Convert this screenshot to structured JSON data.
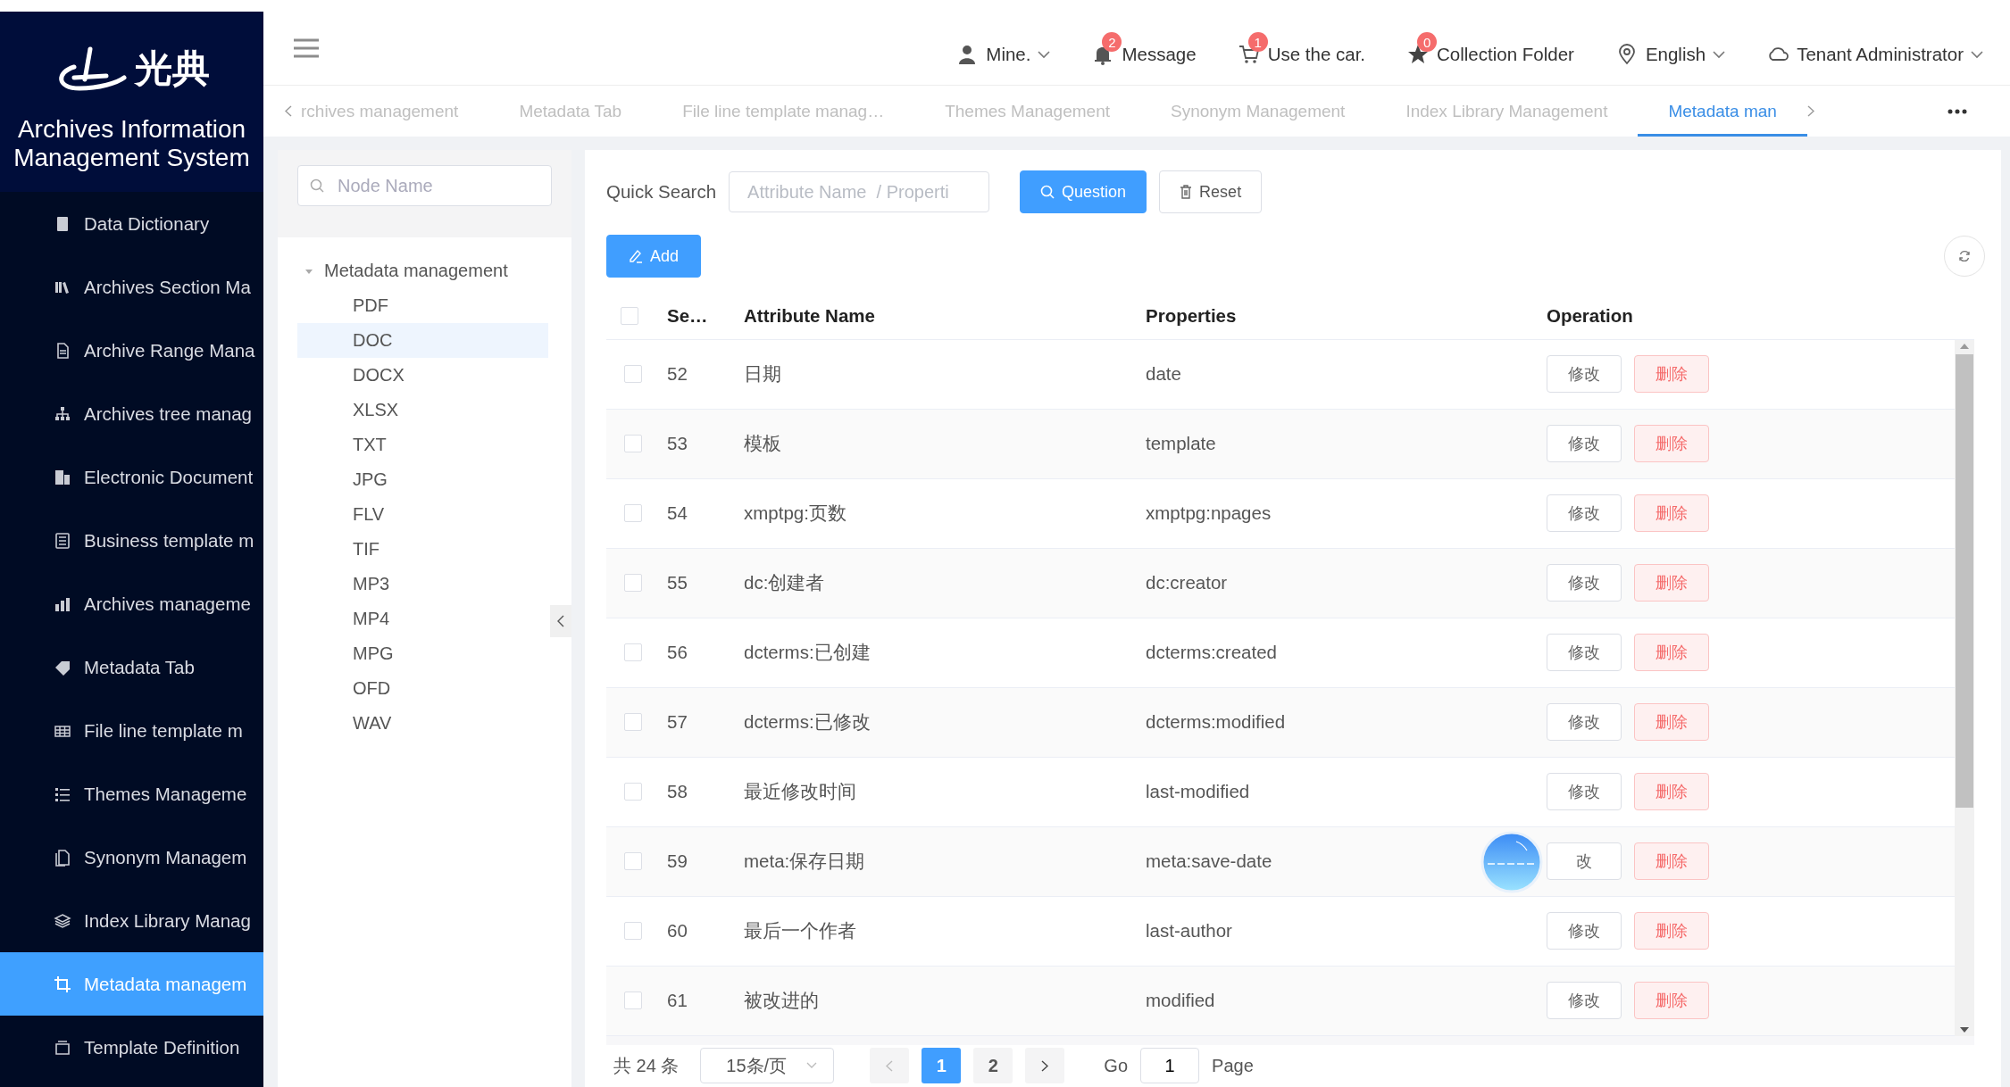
{
  "sidebar": {
    "logo_text": "光典",
    "system_title": "Archives Information Management System",
    "items": [
      {
        "label": "Data Dictionary",
        "selected": false
      },
      {
        "label": "Archives Section Ma",
        "selected": false
      },
      {
        "label": "Archive Range Mana",
        "selected": false
      },
      {
        "label": "Archives tree manag",
        "selected": false
      },
      {
        "label": "Electronic Document",
        "selected": false
      },
      {
        "label": "Business template m",
        "selected": false
      },
      {
        "label": "Archives manageme",
        "selected": false
      },
      {
        "label": "Metadata Tab",
        "selected": false
      },
      {
        "label": "File line template m",
        "selected": false
      },
      {
        "label": "Themes Manageme",
        "selected": false
      },
      {
        "label": "Synonym Managem",
        "selected": false
      },
      {
        "label": "Index Library Manag",
        "selected": false
      },
      {
        "label": "Metadata managem",
        "selected": true
      },
      {
        "label": "Template Definition",
        "selected": false
      }
    ]
  },
  "header": {
    "items": [
      {
        "kind": "user",
        "label": "Mine.",
        "dropdown": true
      },
      {
        "kind": "bell",
        "label": "Message",
        "badge": "2"
      },
      {
        "kind": "cart",
        "label": "Use the car.",
        "badge": "1"
      },
      {
        "kind": "star",
        "label": "Collection Folder",
        "badge": "0"
      },
      {
        "kind": "pin",
        "label": "English",
        "dropdown": true
      },
      {
        "kind": "cloud",
        "label": "Tenant Administrator",
        "dropdown": true
      }
    ]
  },
  "tabs": [
    {
      "label": "rchives management",
      "selected": false
    },
    {
      "label": "Metadata Tab",
      "selected": false
    },
    {
      "label": "File line template manag…",
      "selected": false
    },
    {
      "label": "Themes Management",
      "selected": false
    },
    {
      "label": "Synonym Management",
      "selected": false
    },
    {
      "label": "Index Library Management",
      "selected": false
    },
    {
      "label": "Metadata man",
      "selected": true
    }
  ],
  "tree": {
    "search_placeholder": "Node Name",
    "root": {
      "label": "Metadata management",
      "expanded": true,
      "children": [
        {
          "label": "PDF",
          "selected": false
        },
        {
          "label": "DOC",
          "selected": true
        },
        {
          "label": "DOCX",
          "selected": false
        },
        {
          "label": "XLSX",
          "selected": false
        },
        {
          "label": "TXT",
          "selected": false
        },
        {
          "label": "JPG",
          "selected": false
        },
        {
          "label": "FLV",
          "selected": false
        },
        {
          "label": "TIF",
          "selected": false
        },
        {
          "label": "MP3",
          "selected": false
        },
        {
          "label": "MP4",
          "selected": false
        },
        {
          "label": "MPG",
          "selected": false
        },
        {
          "label": "OFD",
          "selected": false
        },
        {
          "label": "WAV",
          "selected": false
        }
      ]
    }
  },
  "toolbar": {
    "quick_search_label": "Quick Search",
    "search_placeholder": "Attribute Name  / Properti",
    "question_button": "Question",
    "reset_button": "Reset",
    "add_button": "Add"
  },
  "table": {
    "select_all_checked": false,
    "columns": [
      "Se…",
      "Attribute Name",
      "Properties",
      "Operation"
    ],
    "rows": [
      {
        "seq": "52",
        "attribute_name": "日期",
        "properties": "date",
        "edit": "修改",
        "delete": "删除",
        "checked": false
      },
      {
        "seq": "53",
        "attribute_name": "模板",
        "properties": "template",
        "edit": "修改",
        "delete": "删除",
        "checked": false
      },
      {
        "seq": "54",
        "attribute_name": "xmptpg:页数",
        "properties": "xmptpg:npages",
        "edit": "修改",
        "delete": "删除",
        "checked": false
      },
      {
        "seq": "55",
        "attribute_name": "dc:创建者",
        "properties": "dc:creator",
        "edit": "修改",
        "delete": "删除",
        "checked": false
      },
      {
        "seq": "56",
        "attribute_name": "dcterms:已创建",
        "properties": "dcterms:created",
        "edit": "修改",
        "delete": "删除",
        "checked": false
      },
      {
        "seq": "57",
        "attribute_name": "dcterms:已修改",
        "properties": "dcterms:modified",
        "edit": "修改",
        "delete": "删除",
        "checked": false
      },
      {
        "seq": "58",
        "attribute_name": "最近修改时间",
        "properties": "last-modified",
        "edit": "修改",
        "delete": "删除",
        "checked": false
      },
      {
        "seq": "59",
        "attribute_name": "meta:保存日期",
        "properties": "meta:save-date",
        "edit": "改",
        "delete": "删除",
        "checked": false
      },
      {
        "seq": "60",
        "attribute_name": "最后一个作者",
        "properties": "last-author",
        "edit": "修改",
        "delete": "删除",
        "checked": false
      },
      {
        "seq": "61",
        "attribute_name": "被改进的",
        "properties": "modified",
        "edit": "修改",
        "delete": "删除",
        "checked": false
      }
    ]
  },
  "pagination": {
    "total": "共 24 条",
    "page_size": "15条/页",
    "pages": [
      {
        "label": "1",
        "selected": true
      },
      {
        "label": "2",
        "selected": false
      }
    ],
    "go_label": "Go",
    "go_value": "1",
    "page_label": "Page"
  }
}
